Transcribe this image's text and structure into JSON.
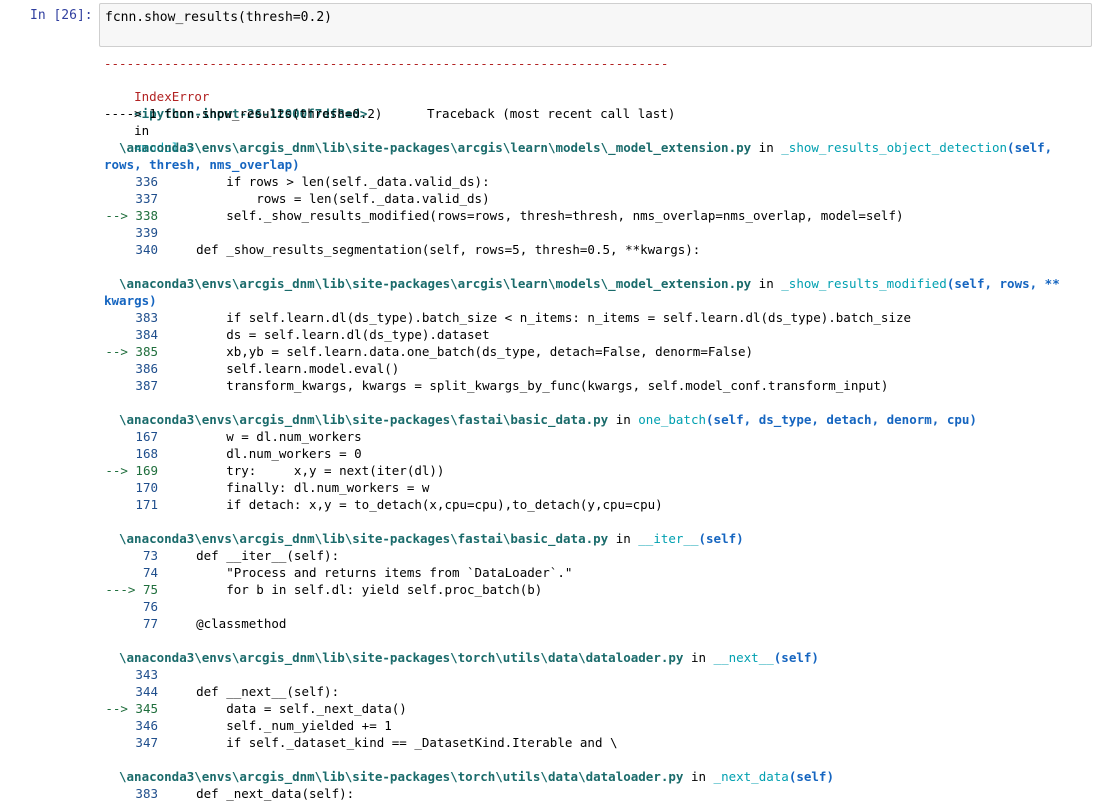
{
  "cell": {
    "prompt": "In [26]:",
    "code": "fcnn.show_results(thresh=0.2)"
  },
  "traceback": {
    "dashes": "---------------------------------------------------------------------------",
    "error_name": "IndexError",
    "header_right": "Traceback (most recent call last)",
    "input_ref": "<ipython-input-26-12000f7df8ed>",
    "in_word": "in",
    "module": "<module>",
    "arrow_line": "----> 1 fcnn.show_results(thresh=0.2)",
    "frames": [
      {
        "path": "\\anaconda3\\envs\\arcgis_dnm\\lib\\site-packages\\arcgis\\learn\\models\\_model_extension.py",
        "in": "in",
        "func": "_show_results_object_detection",
        "args": "(self,",
        "args2": "rows, thresh, nms_overlap)",
        "lines": [
          {
            "no": "336",
            "code": "        if rows > len(self._data.valid_ds):"
          },
          {
            "no": "337",
            "code": "            rows = len(self._data.valid_ds)"
          },
          {
            "no": "--> 338",
            "code": "        self._show_results_modified(rows=rows, thresh=thresh, nms_overlap=nms_overlap, model=self)"
          },
          {
            "no": "339",
            "code": ""
          },
          {
            "no": "340",
            "code": "    def _show_results_segmentation(self, rows=5, thresh=0.5, **kwargs):"
          }
        ]
      },
      {
        "path": "\\anaconda3\\envs\\arcgis_dnm\\lib\\site-packages\\arcgis\\learn\\models\\_model_extension.py",
        "in": "in",
        "func": "_show_results_modified",
        "args": "(self, rows, **",
        "args2": "kwargs)",
        "lines": [
          {
            "no": "383",
            "code": "        if self.learn.dl(ds_type).batch_size < n_items: n_items = self.learn.dl(ds_type).batch_size"
          },
          {
            "no": "384",
            "code": "        ds = self.learn.dl(ds_type).dataset"
          },
          {
            "no": "--> 385",
            "code": "        xb,yb = self.learn.data.one_batch(ds_type, detach=False, denorm=False)"
          },
          {
            "no": "386",
            "code": "        self.learn.model.eval()"
          },
          {
            "no": "387",
            "code": "        transform_kwargs, kwargs = split_kwargs_by_func(kwargs, self.model_conf.transform_input)"
          }
        ]
      },
      {
        "path": "\\anaconda3\\envs\\arcgis_dnm\\lib\\site-packages\\fastai\\basic_data.py",
        "in": "in",
        "func": "one_batch",
        "args": "(self, ds_type, detach, denorm, cpu)",
        "lines": [
          {
            "no": "167",
            "code": "        w = dl.num_workers"
          },
          {
            "no": "168",
            "code": "        dl.num_workers = 0"
          },
          {
            "no": "--> 169",
            "code": "        try:     x,y = next(iter(dl))"
          },
          {
            "no": "170",
            "code": "        finally: dl.num_workers = w"
          },
          {
            "no": "171",
            "code": "        if detach: x,y = to_detach(x,cpu=cpu),to_detach(y,cpu=cpu)"
          }
        ]
      },
      {
        "path": "\\anaconda3\\envs\\arcgis_dnm\\lib\\site-packages\\fastai\\basic_data.py",
        "in": "in",
        "func": "__iter__",
        "args": "(self)",
        "lines": [
          {
            "no": "73",
            "code": "    def __iter__(self):"
          },
          {
            "no": "74",
            "code": "        \"Process and returns items from `DataLoader`.\""
          },
          {
            "no": "---> 75",
            "code": "        for b in self.dl: yield self.proc_batch(b)"
          },
          {
            "no": "76",
            "code": ""
          },
          {
            "no": "77",
            "code": "    @classmethod"
          }
        ]
      },
      {
        "path": "\\anaconda3\\envs\\arcgis_dnm\\lib\\site-packages\\torch\\utils\\data\\dataloader.py",
        "in": "in",
        "func": "__next__",
        "args": "(self)",
        "lines": [
          {
            "no": "343",
            "code": ""
          },
          {
            "no": "344",
            "code": "    def __next__(self):"
          },
          {
            "no": "--> 345",
            "code": "        data = self._next_data()"
          },
          {
            "no": "346",
            "code": "        self._num_yielded += 1"
          },
          {
            "no": "347",
            "code": "        if self._dataset_kind == _DatasetKind.Iterable and \\"
          }
        ]
      },
      {
        "path": "\\anaconda3\\envs\\arcgis_dnm\\lib\\site-packages\\torch\\utils\\data\\dataloader.py",
        "in": "in",
        "func": "_next_data",
        "args": "(self)",
        "lines": [
          {
            "no": "383",
            "code": "    def _next_data(self):"
          }
        ]
      }
    ]
  }
}
